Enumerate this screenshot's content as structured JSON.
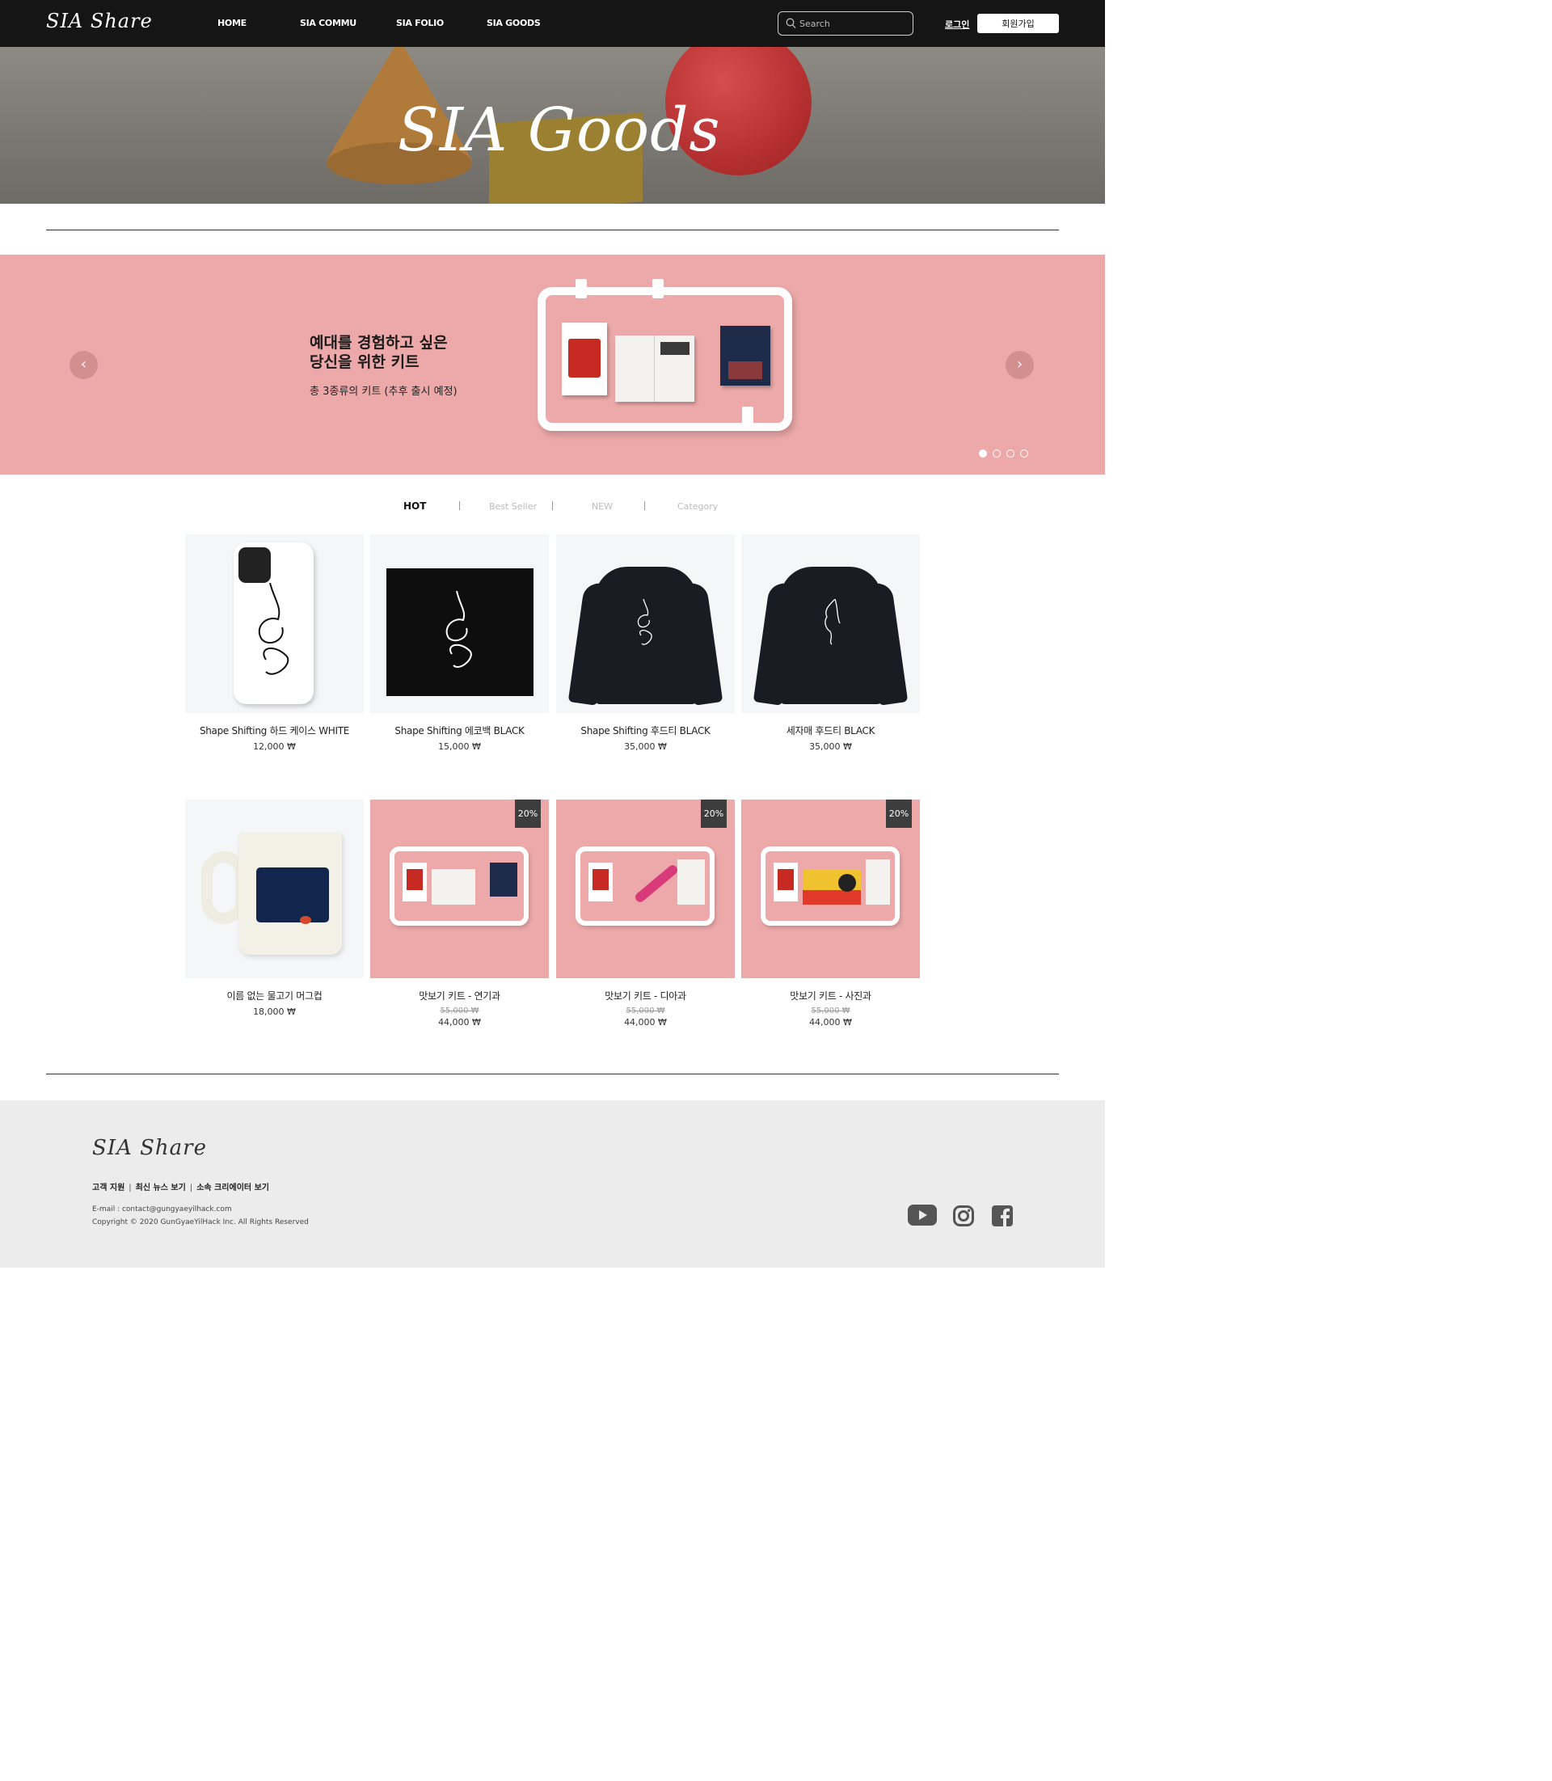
{
  "header": {
    "logo": "SIA Share",
    "nav": [
      "HOME",
      "SIA COMMU",
      "SIA FOLIO",
      "SIA GOODS"
    ],
    "search_placeholder": "Search",
    "login_label": "로그인",
    "signup_label": "회원가입"
  },
  "hero": {
    "title": "SIA Goods"
  },
  "banner": {
    "headline_line1": "예대를 경험하고 싶은",
    "headline_line2": "당신을 위한 키트",
    "subtitle": "총 3종류의 키트 (추후 출시 예정)",
    "prev_arrow": "‹",
    "next_arrow": "›",
    "slide_count": 4,
    "active_slide": 1
  },
  "tabs": [
    "HOT",
    "Best Seller",
    "NEW",
    "Category"
  ],
  "products": [
    {
      "name": "Shape Shifting 하드 케이스 WHITE",
      "price": "12,000 ₩"
    },
    {
      "name": "Shape Shifting 에코백 BLACK",
      "price": "15,000 ₩"
    },
    {
      "name": "Shape Shifting 후드티 BLACK",
      "price": "35,000 ₩"
    },
    {
      "name": "세자매 후드티 BLACK",
      "price": "35,000 ₩"
    },
    {
      "name": "이름 없는 물고기 머그컵",
      "price": "18,000 ₩"
    },
    {
      "name": "맛보기 키트 - 연기과",
      "old_price": "55,000 ₩",
      "price": "44,000 ₩",
      "badge": "20%"
    },
    {
      "name": "맛보기 키트 - 디아과",
      "old_price": "55,000 ₩",
      "price": "44,000 ₩",
      "badge": "20%"
    },
    {
      "name": "맛보기 키트 - 사진과",
      "old_price": "55,000 ₩",
      "price": "44,000 ₩",
      "badge": "20%"
    }
  ],
  "footer": {
    "logo": "SIA Share",
    "links": [
      "고객 지원",
      "최신 뉴스 보기",
      "소속 크리에이터 보기"
    ],
    "email": "E-mail : contact@gungyaeyilhack.com",
    "copyright": "Copyright © 2020 GunGyaeYilHack Inc. All Rights Reserved",
    "social": [
      "youtube-icon",
      "instagram-icon",
      "facebook-icon"
    ]
  },
  "colors": {
    "header_bg": "#151515",
    "banner_bg": "#eda9a9",
    "footer_bg": "#ececec",
    "badge_bg": "#3d3d3d"
  }
}
